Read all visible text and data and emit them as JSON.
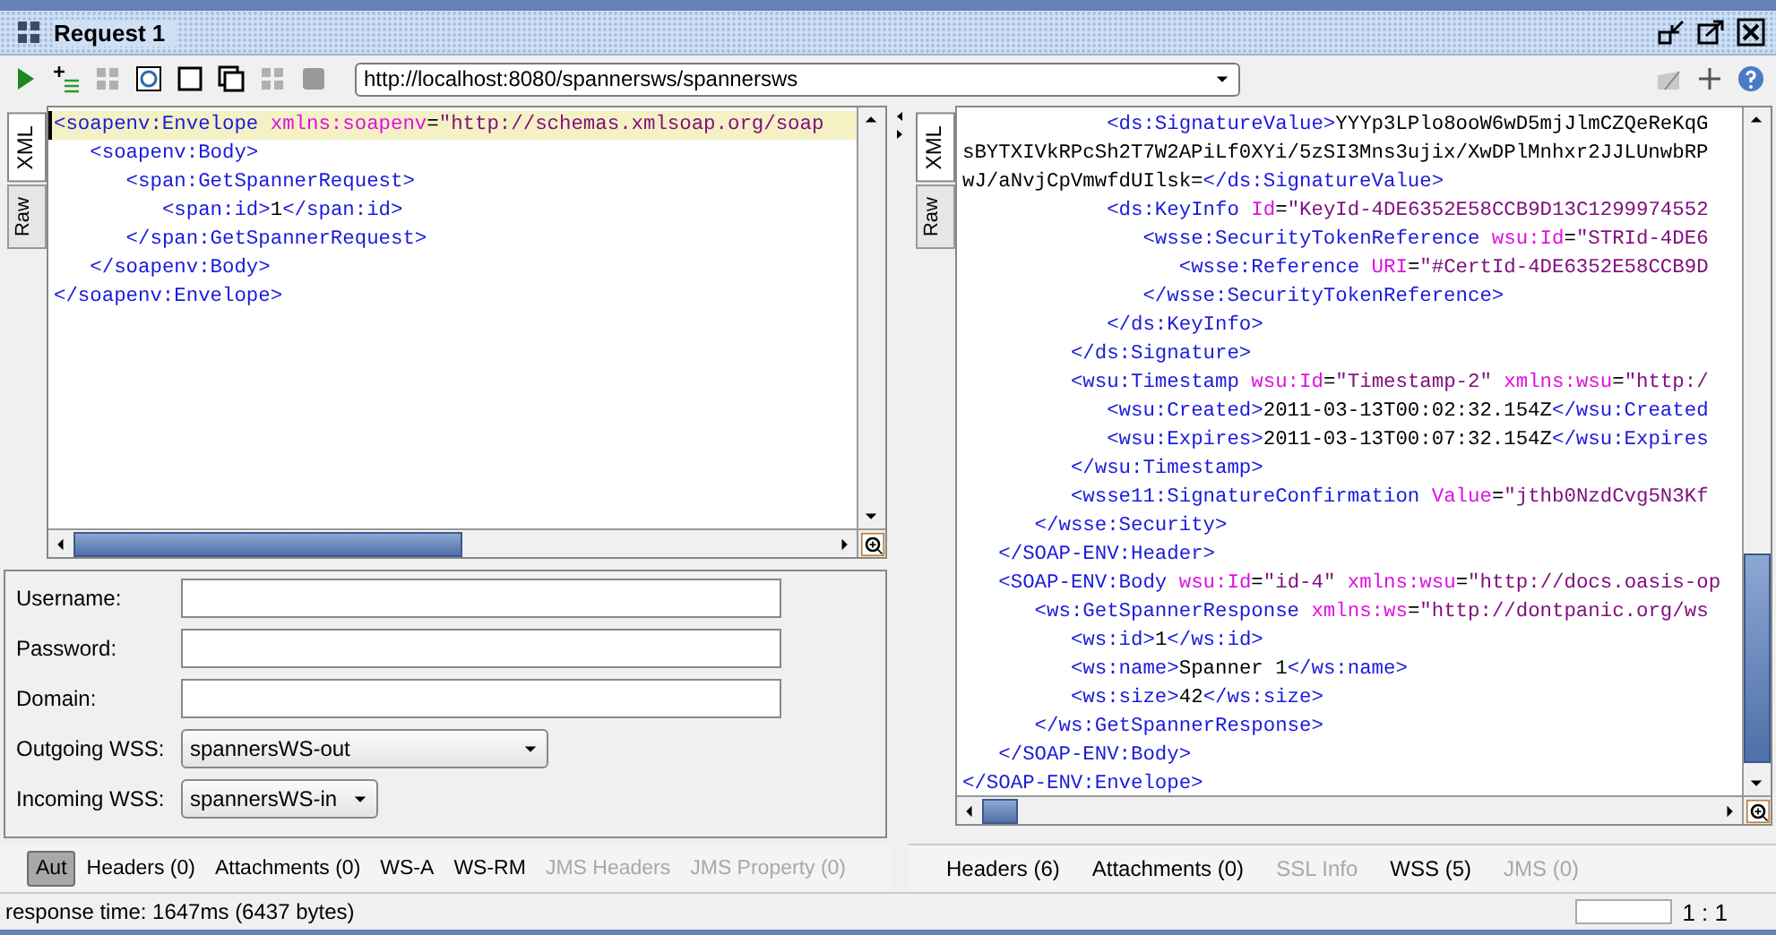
{
  "window": {
    "title": "Request 1"
  },
  "toolbar": {
    "endpoint": "http://localhost:8080/spannersws/spannersws"
  },
  "request_editor": {
    "tabs": [
      {
        "label": "XML",
        "selected": true
      },
      {
        "label": "Raw",
        "selected": false
      }
    ],
    "lines": [
      {
        "text": "<soapenv:Envelope xmlns:soapenv=\"http://schemas.xmlsoap.org/soap",
        "current": true
      },
      {
        "text": "   <soapenv:Body>",
        "current": false
      },
      {
        "text": "      <span:GetSpannerRequest>",
        "current": false
      },
      {
        "text": "         <span:id>1</span:id>",
        "current": false
      },
      {
        "text": "      </span:GetSpannerRequest>",
        "current": false
      },
      {
        "text": "   </soapenv:Body>",
        "current": false
      },
      {
        "text": "</soapenv:Envelope>",
        "current": false
      }
    ]
  },
  "auth": {
    "fields": [
      {
        "label": "Username:",
        "kind": "input"
      },
      {
        "label": "Password:",
        "kind": "input"
      },
      {
        "label": "Domain:",
        "kind": "input"
      },
      {
        "label": "Outgoing WSS:",
        "kind": "select",
        "value": "spannersWS-out"
      },
      {
        "label": "Incoming WSS:",
        "kind": "select",
        "value": "spannersWS-in"
      }
    ]
  },
  "request_tabs": [
    {
      "label": "Aut",
      "selected": true,
      "disabled": false
    },
    {
      "label": "Headers (0)",
      "selected": false,
      "disabled": false
    },
    {
      "label": "Attachments (0)",
      "selected": false,
      "disabled": false
    },
    {
      "label": "WS-A",
      "selected": false,
      "disabled": false
    },
    {
      "label": "WS-RM",
      "selected": false,
      "disabled": false
    },
    {
      "label": "JMS Headers",
      "selected": false,
      "disabled": true
    },
    {
      "label": "JMS Property (0)",
      "selected": false,
      "disabled": true
    }
  ],
  "response_editor": {
    "tabs": [
      {
        "label": "XML",
        "selected": true
      },
      {
        "label": "Raw",
        "selected": false
      }
    ],
    "lines": [
      {
        "text": "            <ds:SignatureValue>YYYp3LPlo8ooW6wD5mjJlmCZQeReKqG",
        "current": false
      },
      {
        "text": "sBYTXIVkRPcSh2T7W2APiLf0XYi/5zSI3Mns3ujix/XwDPlMnhxr2JJLUnwbRP",
        "current": false
      },
      {
        "text": "wJ/aNvjCpVmwfdUIlsk=</ds:SignatureValue>",
        "current": false
      },
      {
        "text": "            <ds:KeyInfo Id=\"KeyId-4DE6352E58CCB9D13C1299974552",
        "current": false
      },
      {
        "text": "               <wsse:SecurityTokenReference wsu:Id=\"STRId-4DE6",
        "current": false
      },
      {
        "text": "                  <wsse:Reference URI=\"#CertId-4DE6352E58CCB9D",
        "current": false
      },
      {
        "text": "               </wsse:SecurityTokenReference>",
        "current": false
      },
      {
        "text": "            </ds:KeyInfo>",
        "current": false
      },
      {
        "text": "         </ds:Signature>",
        "current": false
      },
      {
        "text": "         <wsu:Timestamp wsu:Id=\"Timestamp-2\" xmlns:wsu=\"http:/",
        "current": false
      },
      {
        "text": "            <wsu:Created>2011-03-13T00:02:32.154Z</wsu:Created",
        "current": false
      },
      {
        "text": "            <wsu:Expires>2011-03-13T00:07:32.154Z</wsu:Expires",
        "current": false
      },
      {
        "text": "         </wsu:Timestamp>",
        "current": false
      },
      {
        "text": "         <wsse11:SignatureConfirmation Value=\"jthb0NzdCvg5N3Kf",
        "current": false
      },
      {
        "text": "      </wsse:Security>",
        "current": false
      },
      {
        "text": "   </SOAP-ENV:Header>",
        "current": false
      },
      {
        "text": "   <SOAP-ENV:Body wsu:Id=\"id-4\" xmlns:wsu=\"http://docs.oasis-op",
        "current": false
      },
      {
        "text": "      <ws:GetSpannerResponse xmlns:ws=\"http://dontpanic.org/ws",
        "current": false
      },
      {
        "text": "         <ws:id>1</ws:id>",
        "current": false
      },
      {
        "text": "         <ws:name>Spanner 1</ws:name>",
        "current": false
      },
      {
        "text": "         <ws:size>42</ws:size>",
        "current": false
      },
      {
        "text": "      </ws:GetSpannerResponse>",
        "current": false
      },
      {
        "text": "   </SOAP-ENV:Body>",
        "current": false
      },
      {
        "text": "</SOAP-ENV:Envelope>",
        "current": false
      }
    ]
  },
  "response_tabs": [
    {
      "label": "Headers (6)",
      "selected": false,
      "disabled": false
    },
    {
      "label": "Attachments (0)",
      "selected": false,
      "disabled": false
    },
    {
      "label": "SSL Info",
      "selected": false,
      "disabled": true
    },
    {
      "label": "WSS (5)",
      "selected": false,
      "disabled": false
    },
    {
      "label": "JMS (0)",
      "selected": false,
      "disabled": true
    }
  ],
  "status_bar": {
    "text": "response time: 1647ms (6437 bytes)",
    "position": "1 : 1"
  }
}
